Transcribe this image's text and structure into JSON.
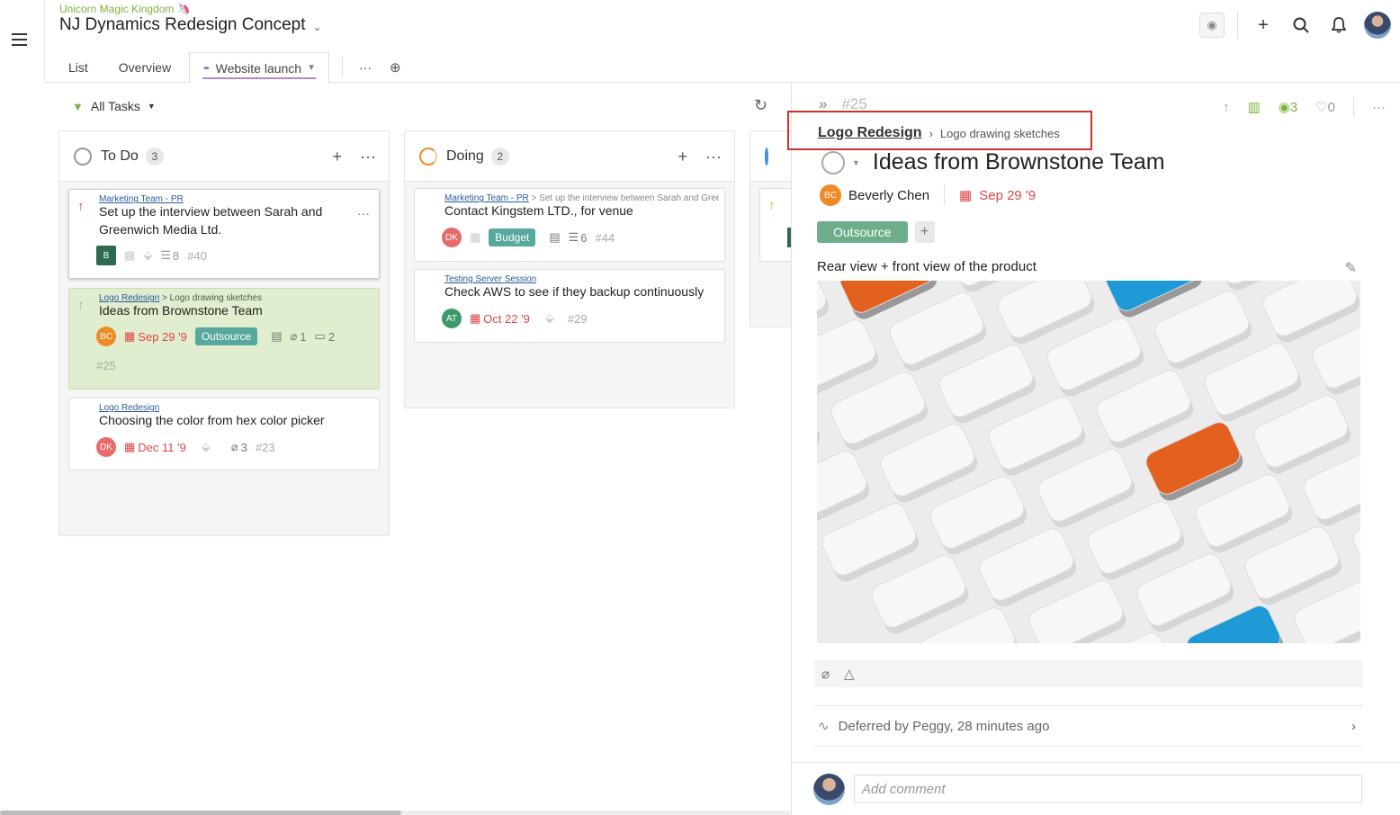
{
  "header": {
    "workspace": "Unicorn Magic Kingdom 🦄",
    "project_title": "NJ Dynamics Redesign Concept",
    "tabs": [
      "List",
      "Overview"
    ],
    "active_tab": "Website launch",
    "more": "···"
  },
  "toolbar": {
    "filter_label": "All Tasks"
  },
  "columns": [
    {
      "name": "To Do",
      "count": "3",
      "cards": [
        {
          "crumb": "Marketing Team - PR",
          "title": "Set up the interview between Sarah and Greenwich Media Ltd.",
          "avatar": "B",
          "subtasks": "8",
          "id": "#40"
        },
        {
          "crumb_link": "Logo Redesign",
          "crumb_rest": "> Logo drawing sketches",
          "title": "Ideas from Brownstone Team",
          "avatar": "BC",
          "due": "Sep 29 '9",
          "tag": "Outsource",
          "attachments": "1",
          "comments": "2",
          "id": "#25"
        },
        {
          "crumb": "Logo Redesign",
          "title": "Choosing the color from hex color picker",
          "avatar": "DK",
          "due": "Dec 11 '9",
          "attachments": "3",
          "id": "#23"
        }
      ]
    },
    {
      "name": "Doing",
      "count": "2",
      "cards": [
        {
          "crumb_link": "Marketing Team - PR",
          "crumb_rest": "> Set up the interview between Sarah and Greenwich",
          "title": "Contact Kingstem LTD., for venue",
          "avatar": "DK",
          "tag": "Budget",
          "subtasks": "6",
          "id": "#44"
        },
        {
          "crumb": "Testing Server Session",
          "title": "Check AWS to see if they backup continuously",
          "avatar": "AT",
          "due": "Oct 22 '9",
          "id": "#29"
        }
      ]
    }
  ],
  "panel": {
    "task_id": "#25",
    "watchers": "3",
    "likes": "0",
    "crumb_link": "Logo Redesign",
    "crumb_sub": "Logo drawing sketches",
    "title": "Ideas from Brownstone Team",
    "assignee_initials": "BC",
    "assignee": "Beverly Chen",
    "due": "Sep 29 '9",
    "tag": "Outsource",
    "description": "Rear view + front view of the product",
    "activity": "Deferred by Peggy, 28 minutes ago",
    "comment_placeholder": "Add comment"
  },
  "colors": {
    "accent": "#7cb342",
    "due": "#e04646",
    "tag": "#57a89e",
    "highlight": "#d32f2f"
  }
}
